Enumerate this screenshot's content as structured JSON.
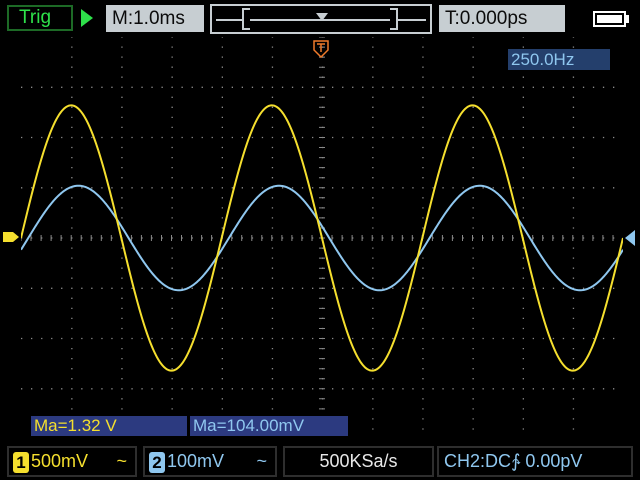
{
  "topbar": {
    "trigger_status": "Trig",
    "run_state_icon": "play-icon",
    "timebase": "M:1.0ms",
    "trigger_position": "T:0.000ps",
    "battery_icon": "battery-icon"
  },
  "display": {
    "frequency_readout": "250.0Hz",
    "measurement_ch1": "Ma=1.32 V",
    "measurement_ch2": "Ma=104.00mV",
    "trigger_marker_icon": "trigger-t-icon",
    "ch1_marker_icon": "ch1-ground-marker-icon",
    "ch2_marker_icon": "ch2-ground-marker-icon"
  },
  "bottombar": {
    "ch1_number": "1",
    "ch1_scale": "500mV",
    "ch1_coupling": "~",
    "ch2_number": "2",
    "ch2_scale": "100mV",
    "ch2_coupling": "~",
    "sample_rate": "500KSa/s",
    "trigger_setting": "CH2:DC∱  0.00pV"
  },
  "colors": {
    "ch1": "#f5df2e",
    "ch2": "#8fc7ef",
    "grid": "#8a8a8a",
    "status_green": "#2ee14a",
    "trigger_marker": "#f07a2a"
  },
  "waveforms": {
    "ch1": {
      "frequency_hz": 250.0,
      "amplitude_divs": 2.64,
      "offset_divs": 0.0
    },
    "ch2": {
      "frequency_hz": 250.0,
      "amplitude_divs": 1.04,
      "offset_divs": 0.0
    }
  }
}
